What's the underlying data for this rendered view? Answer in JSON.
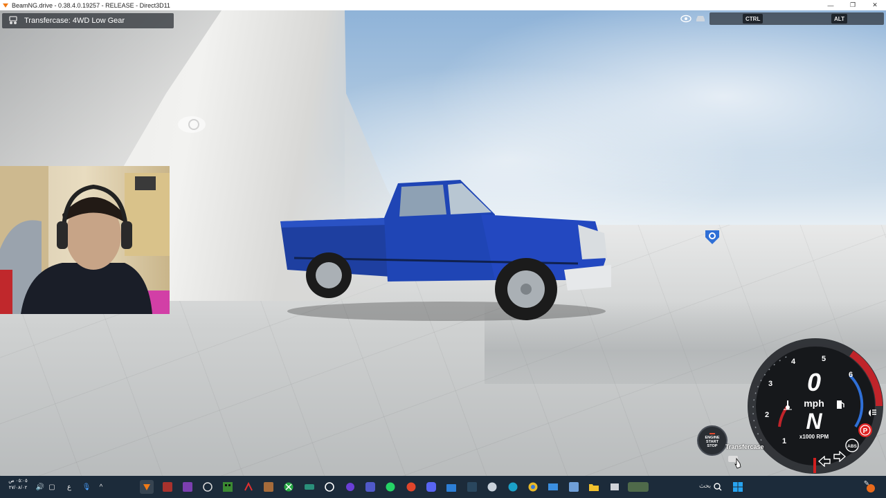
{
  "window": {
    "title": "BeamNG.drive - 0.38.4.0.19257 - RELEASE - Direct3D11",
    "controls": [
      "minimize-icon",
      "restore-icon",
      "close-icon"
    ]
  },
  "notification": {
    "icon": "transfercase-icon",
    "text": "Transfercase: 4WD Low Gear"
  },
  "top_right": {
    "icons": [
      "eye-icon",
      "car-icon"
    ],
    "keys": [
      "CTRL",
      "ALT"
    ]
  },
  "dashboard": {
    "speed": "0",
    "speed_unit": "mph",
    "gear": "N",
    "rpm_label": "x1000 RPM",
    "rpm_ticks": [
      "1",
      "2",
      "3",
      "4",
      "5",
      "6"
    ],
    "engine_button": [
      "ENGINE",
      "START",
      "STOP"
    ],
    "transfer_label": "Transfercase",
    "indicators": [
      "temperature-icon",
      "fuel-icon",
      "headlight-icon",
      "parking-brake-icon",
      "abs-icon",
      "left-turn-icon",
      "right-turn-icon"
    ],
    "parking_label": "P",
    "abs_label": "ABS",
    "colors": {
      "redline": "#c0242a",
      "accent_blue": "#2f6fd6"
    }
  },
  "taskbar": {
    "clock_time": "٠٥:٠٥ ص",
    "clock_date": "٢٧/٠٨/٠٢",
    "lang": "ع",
    "search_text": "بحث",
    "app_icons": [
      "beamng-icon",
      "game-icon-1",
      "game-icon-2",
      "obs-icon",
      "minecraft-icon",
      "acrobat-icon",
      "explorer-game-icon",
      "xbox-icon",
      "app-icon-1",
      "app-icon-2",
      "app-icon-3",
      "teams-icon",
      "whatsapp-icon",
      "app-icon-4",
      "discord-icon",
      "store-icon",
      "steam-icon",
      "steam-alt-icon",
      "edge-icon",
      "chrome-icon",
      "mail-icon",
      "app-icon-5",
      "folder-icon",
      "app-icon-6"
    ],
    "widget": "weather-widget-icon",
    "start": "windows-start-icon"
  }
}
